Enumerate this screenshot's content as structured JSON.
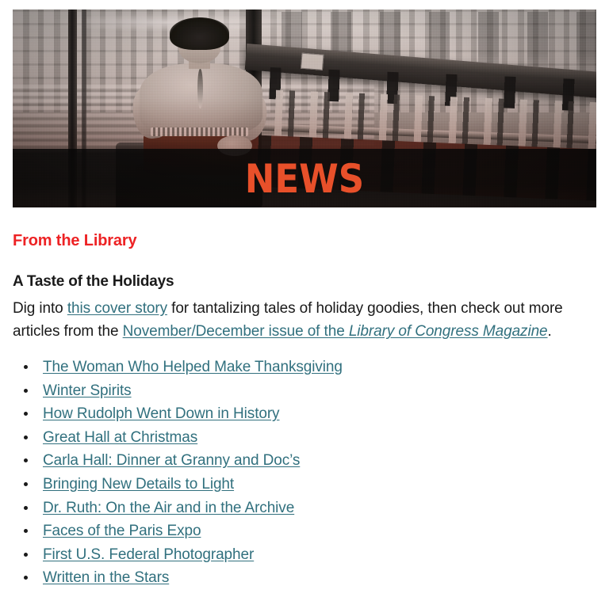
{
  "hero": {
    "alt": "Black and white vintage photograph of a woman working at a long industrial printing and binding machine in a factory",
    "overlay_label": "NEWS",
    "label_color": "#e8502a"
  },
  "section": {
    "kicker": "From the Library",
    "kicker_color": "#ed2224",
    "subhead": "A Taste of the Holidays",
    "lede": {
      "before_link": "Dig into ",
      "link_1": "this cover story",
      "middle": " for tantalizing tales of holiday goodies, then check out more articles from the ",
      "link_2_prefix": "November/December issue of the ",
      "link_2_italic": "Library of Congress Magazine",
      "after": "."
    },
    "link_color": "#31707e"
  },
  "article_links": [
    "The Woman Who Helped Make Thanksgiving",
    "Winter Spirits",
    "How Rudolph Went Down in History",
    "Great Hall at Christmas",
    "Carla Hall: Dinner at Granny and Doc’s",
    "Bringing New Details to Light",
    "Dr. Ruth: On the Air and in the Archive",
    "Faces of the Paris Expo",
    "First U.S. Federal Photographer",
    "Written in the Stars"
  ]
}
